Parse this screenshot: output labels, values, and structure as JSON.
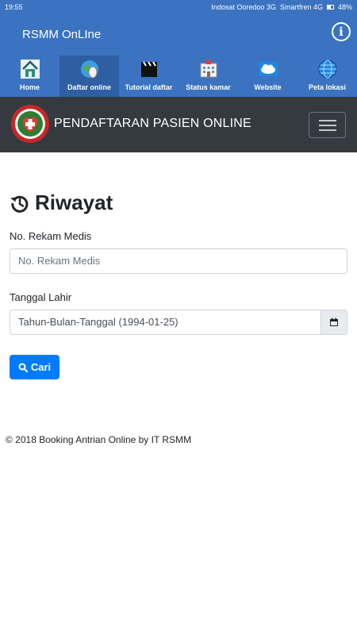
{
  "status_bar": {
    "time": "19:55",
    "carrier1": "Indosat Ooredoo 3G",
    "carrier2": "Smartfren 4G",
    "battery": "48%"
  },
  "app_bar": {
    "title": "RSMM OnLIne",
    "info_icon": "info-icon"
  },
  "nav": {
    "items": [
      {
        "label": "Home",
        "icon": "house-icon",
        "active": false
      },
      {
        "label": "Daftar online",
        "icon": "mouse-globe-icon",
        "active": true
      },
      {
        "label": "Tutorial daftar",
        "icon": "clapperboard-icon",
        "active": false
      },
      {
        "label": "Status kamar",
        "icon": "hospital-building-icon",
        "active": false
      },
      {
        "label": "Website",
        "icon": "cloud-icon",
        "active": false
      },
      {
        "label": "Peta lokasi",
        "icon": "globe-icon",
        "active": false
      }
    ]
  },
  "brand": {
    "title": "PENDAFTARAN PASIEN ONLINE"
  },
  "main": {
    "heading": "Riwayat",
    "rekam_medis_label": "No. Rekam Medis",
    "rekam_medis_placeholder": "No. Rekam Medis",
    "tanggal_label": "Tanggal Lahir",
    "tanggal_placeholder": "Tahun-Bulan-Tanggal (1994-01-25)",
    "search_label": "Cari"
  },
  "footer": {
    "text": "© 2018 Booking Antrian Online by IT RSMM"
  },
  "colors": {
    "app_bar": "#3b73c0",
    "nav_active": "#2f5fa3",
    "brand_bar": "#343a40",
    "primary_button": "#007bff"
  }
}
